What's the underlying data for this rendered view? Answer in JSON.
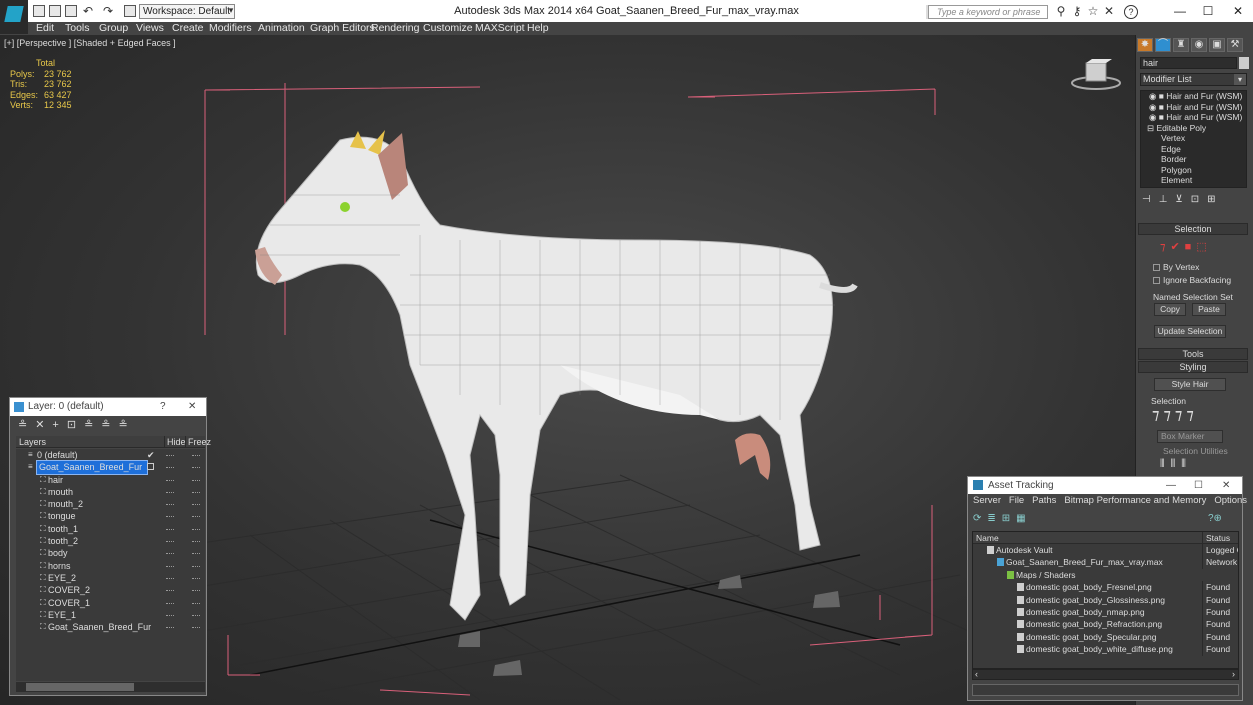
{
  "titlebar": {
    "workspace": "Workspace: Default",
    "app_title": "Autodesk 3ds Max  2014 x64      Goat_Saanen_Breed_Fur_max_vray.max",
    "search_placeholder": "Type a keyword or phrase"
  },
  "menu": [
    "Edit",
    "Tools",
    "Group",
    "Views",
    "Create",
    "Modifiers",
    "Animation",
    "Graph Editors",
    "Rendering",
    "Customize",
    "MAXScript",
    "Help"
  ],
  "viewport": {
    "label": "[+] [Perspective ] [Shaded + Edged Faces ]",
    "stats_header": "Total",
    "stats": [
      {
        "k": "Polys:",
        "v": "23 762"
      },
      {
        "k": "Tris:",
        "v": "23 762"
      },
      {
        "k": "Edges:",
        "v": "63 427"
      },
      {
        "k": "Verts:",
        "v": "12 345"
      }
    ]
  },
  "command_panel": {
    "object_name": "hair",
    "modifier_list": "Modifier List",
    "stack": [
      "Hair and Fur (WSM)",
      "Hair and Fur (WSM)",
      "Hair and Fur (WSM)",
      "Editable Poly",
      "Vertex",
      "Edge",
      "Border",
      "Polygon",
      "Element"
    ],
    "selection_title": "Selection",
    "by_vertex": "By Vertex",
    "ignore_backfacing": "Ignore Backfacing",
    "named_sel": "Named Selection Set",
    "copy": "Copy",
    "paste": "Paste",
    "update_selection": "Update Selection",
    "tools": "Tools",
    "styling": "Styling",
    "style_hair": "Style Hair",
    "selection_sub": "Selection",
    "box_marker": "Box Marker",
    "selection_utilities": "Selection Utilities"
  },
  "layer_window": {
    "title": "Layer: 0 (default)",
    "help": "?",
    "col_layers": "Layers",
    "col_hide": "Hide",
    "col_freeze": "Freez",
    "rows": [
      {
        "name": "0 (default)",
        "indent": 0,
        "selected": false
      },
      {
        "name": "Goat_Saanen_Breed_Fur",
        "indent": 0,
        "selected": true
      },
      {
        "name": "hair",
        "indent": 1,
        "selected": false
      },
      {
        "name": "mouth",
        "indent": 1,
        "selected": false
      },
      {
        "name": "mouth_2",
        "indent": 1,
        "selected": false
      },
      {
        "name": "tongue",
        "indent": 1,
        "selected": false
      },
      {
        "name": "tooth_1",
        "indent": 1,
        "selected": false
      },
      {
        "name": "tooth_2",
        "indent": 1,
        "selected": false
      },
      {
        "name": "body",
        "indent": 1,
        "selected": false
      },
      {
        "name": "horns",
        "indent": 1,
        "selected": false
      },
      {
        "name": "EYE_2",
        "indent": 1,
        "selected": false
      },
      {
        "name": "COVER_2",
        "indent": 1,
        "selected": false
      },
      {
        "name": "COVER_1",
        "indent": 1,
        "selected": false
      },
      {
        "name": "EYE_1",
        "indent": 1,
        "selected": false
      },
      {
        "name": "Goat_Saanen_Breed_Fur",
        "indent": 1,
        "selected": false
      }
    ]
  },
  "asset_window": {
    "title": "Asset Tracking",
    "menu": [
      "Server",
      "File",
      "Paths",
      "Bitmap Performance and Memory",
      "Options"
    ],
    "col_name": "Name",
    "col_status": "Status",
    "rows": [
      {
        "name": "Autodesk Vault",
        "status": "Logged Ou",
        "indent": 0
      },
      {
        "name": "Goat_Saanen_Breed_Fur_max_vray.max",
        "status": "Network P",
        "indent": 1
      },
      {
        "name": "Maps / Shaders",
        "status": "",
        "indent": 2
      },
      {
        "name": "domestic goat_body_Fresnel.png",
        "status": "Found",
        "indent": 3
      },
      {
        "name": "domestic goat_body_Glossiness.png",
        "status": "Found",
        "indent": 3
      },
      {
        "name": "domestic goat_body_nmap.png",
        "status": "Found",
        "indent": 3
      },
      {
        "name": "domestic goat_body_Refraction.png",
        "status": "Found",
        "indent": 3
      },
      {
        "name": "domestic goat_body_Specular.png",
        "status": "Found",
        "indent": 3
      },
      {
        "name": "domestic goat_body_white_diffuse.png",
        "status": "Found",
        "indent": 3
      }
    ]
  },
  "colors": {
    "accent": "#1e6fd9",
    "stats": "#e8c84a",
    "bbox": "#d9607a"
  }
}
